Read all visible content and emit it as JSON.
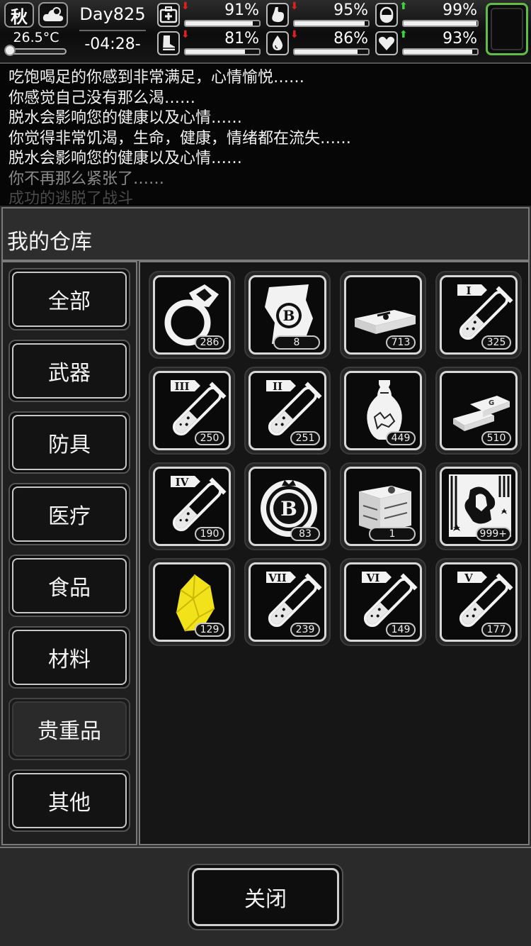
{
  "status": {
    "season": "秋",
    "weather_icon": "cloud-moon-icon",
    "temperature": "26.5°C",
    "temperature_level": 0.12,
    "day": "Day825",
    "time": "-04:28-",
    "stats": [
      {
        "name": "health",
        "icon": "first-aid-icon",
        "trend": "down",
        "value": "91%",
        "level": 0.91
      },
      {
        "name": "hunger",
        "icon": "stomach-icon",
        "trend": "down",
        "value": "95%",
        "level": 0.95
      },
      {
        "name": "medicine",
        "icon": "pill-icon",
        "trend": "up",
        "value": "99%",
        "level": 0.99
      },
      {
        "name": "stamina",
        "icon": "boot-icon",
        "trend": "down",
        "value": "81%",
        "level": 0.81
      },
      {
        "name": "thirst",
        "icon": "water-drop-icon",
        "trend": "down",
        "value": "86%",
        "level": 0.86
      },
      {
        "name": "mood",
        "icon": "heart-icon",
        "trend": "up",
        "value": "93%",
        "level": 0.93
      }
    ],
    "colors": {
      "trend_up": "#3fd13f",
      "trend_down": "#e02020",
      "slot_border": "#5fbf45"
    }
  },
  "log": [
    "吃饱喝足的你感到非常满足，心情愉悦……",
    "你感觉自己没有那么渴……",
    "脱水会影响您的健康以及心情……",
    "你觉得非常饥渴，生命，健康，情绪都在流失……",
    "脱水会影响您的健康以及心情……",
    "你不再那么紧张了……",
    "成功的逃脱了战斗"
  ],
  "warehouse": {
    "title": "我的仓库",
    "categories": [
      "全部",
      "武器",
      "防具",
      "医疗",
      "食品",
      "材料",
      "贵重品",
      "其他"
    ],
    "active_category": "贵重品",
    "items": [
      {
        "icon": "diamond-ring-icon",
        "count": "286"
      },
      {
        "icon": "bitcoin-scroll-icon",
        "count": "8"
      },
      {
        "icon": "cash-stack-icon",
        "count": "713"
      },
      {
        "icon": "test-tube-1-icon",
        "count": "325"
      },
      {
        "icon": "test-tube-3-icon",
        "count": "250"
      },
      {
        "icon": "test-tube-2-icon",
        "count": "251"
      },
      {
        "icon": "porcelain-vase-icon",
        "count": "449"
      },
      {
        "icon": "gold-bars-icon",
        "count": "510"
      },
      {
        "icon": "test-tube-4-icon",
        "count": "190"
      },
      {
        "icon": "bitcoin-chip-icon",
        "count": "83"
      },
      {
        "icon": "treasure-chest-icon",
        "count": "1"
      },
      {
        "icon": "zombie-card-icon",
        "count": "999+"
      },
      {
        "icon": "yellow-crystal-icon",
        "count": "129"
      },
      {
        "icon": "test-tube-7-icon",
        "count": "239"
      },
      {
        "icon": "test-tube-6-icon",
        "count": "149"
      },
      {
        "icon": "test-tube-5-icon",
        "count": "177"
      }
    ],
    "tube_labels": {
      "test-tube-1-icon": "I",
      "test-tube-2-icon": "II",
      "test-tube-3-icon": "III",
      "test-tube-4-icon": "IV",
      "test-tube-5-icon": "V",
      "test-tube-6-icon": "VI",
      "test-tube-7-icon": "VII"
    },
    "close_label": "关闭",
    "crystal_color": "#f2e21a"
  }
}
